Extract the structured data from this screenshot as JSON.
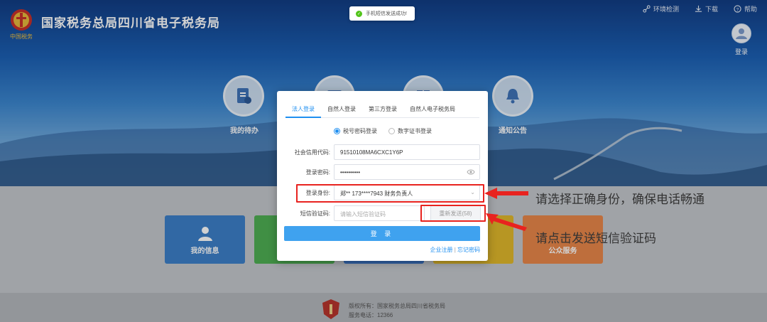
{
  "header": {
    "site_title": "国家税务总局四川省电子税务局",
    "logo_caption": "中国税务",
    "links": [
      {
        "label": "环境检测",
        "icon": "network-check-icon"
      },
      {
        "label": "下载",
        "icon": "download-icon"
      },
      {
        "label": "帮助",
        "icon": "help-icon"
      }
    ],
    "login_label": "登录"
  },
  "toast": {
    "message": "手机短信发送成功!"
  },
  "quick_circles": [
    {
      "label": "我的待办",
      "icon": "document-icon"
    },
    {
      "label": "",
      "icon": "calendar-icon"
    },
    {
      "label": "",
      "icon": "book-icon"
    },
    {
      "label": "通知公告",
      "icon": "bell-icon"
    }
  ],
  "tiles": [
    {
      "label": "我的信息",
      "icon": "person-icon",
      "color": "#3c7fc9"
    },
    {
      "label": "",
      "icon": "",
      "color": "#4faf53"
    },
    {
      "label": "",
      "icon": "",
      "color": "#3a72c3"
    },
    {
      "label": "",
      "icon": "",
      "color": "#e0b82b"
    },
    {
      "label": "公众服务",
      "icon": "",
      "color": "#e8874a"
    }
  ],
  "dialog": {
    "tabs": [
      "法人登录",
      "自然人登录",
      "第三方登录",
      "自然人电子税务局"
    ],
    "active_tab": 0,
    "login_modes": [
      {
        "label": "税号密码登录",
        "selected": true
      },
      {
        "label": "数字证书登录",
        "selected": false
      }
    ],
    "fields": {
      "credit_code": {
        "label": "社会信用代码:",
        "value": "91510108MA6CXC1Y6P"
      },
      "password": {
        "label": "登录密码:",
        "value": "••••••••••"
      },
      "identity": {
        "label": "登录身份:",
        "value": "郑** 173****7943 财务负责人"
      },
      "sms_code": {
        "label": "短信验证码:",
        "placeholder": "请输入短信验证码"
      }
    },
    "resend_label": "重新发送(58)",
    "login_button": "登 录",
    "link_register": "企业注册",
    "link_separator": "|",
    "link_forgot": "忘记密码"
  },
  "annotations": {
    "identity_hint": "请选择正确身份，确保电话畅通",
    "sms_hint": "请点击发送短信验证码"
  },
  "footer": {
    "copyright": "版权所有：国家税务总局四川省税务局",
    "hotline": "服务电话：12366"
  },
  "colors": {
    "accent": "#1f8ff0",
    "login_button": "#3fa2ef",
    "annotation_red": "#e8231f"
  }
}
